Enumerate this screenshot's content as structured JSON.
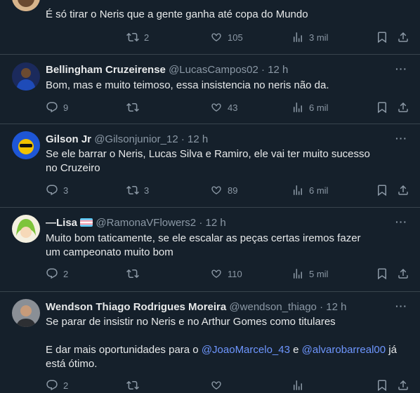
{
  "tweets": [
    {
      "text": "É só tirar o Neris que a gente ganha até copa do Mundo",
      "retweets": "2",
      "likes": "105",
      "views": "3 mil"
    },
    {
      "name": "Bellingham Cruzeirense",
      "handle": "@LucasCampos02",
      "time": "· 12 h",
      "text": "Bom, mas e muito teimoso, essa insistencia no neris não da.",
      "replies": "9",
      "likes": "43",
      "views": "6 mil"
    },
    {
      "name": "Gilson Jr",
      "handle": "@Gilsonjunior_12",
      "time": "· 12 h",
      "text": "Se ele barrar o Neris, Lucas Silva e Ramiro, ele vai ter muito sucesso no Cruzeiro",
      "replies": "3",
      "retweets": "3",
      "likes": "89",
      "views": "6 mil"
    },
    {
      "name": "—Lisa",
      "handle": "@RamonaVFlowers2",
      "time": "· 12 h",
      "text": "Muito bom taticamente, se ele escalar as peças certas iremos fazer um campeonato muito bom",
      "replies": "2",
      "likes": "110",
      "views": "5 mil"
    },
    {
      "name": "Wendson Thiago Rodrigues Moreira",
      "handle": "@wendson_thiago",
      "time": "· 12 h",
      "text_line1": "Se parar de insistir no Neris e no Arthur Gomes como titulares",
      "text_line2_start": "E dar mais oportunidades para o ",
      "mention1": "@JoaoMarcelo_43",
      "conj": " e ",
      "mention2": "@alvarobarreal00",
      "text_line2_end": " já está ótimo.",
      "replies": "2"
    }
  ],
  "more_label": "···",
  "colors": {
    "background": "#15202b",
    "divider": "#38444d",
    "muted": "#8b98a5",
    "mention": "#6e96ff"
  }
}
